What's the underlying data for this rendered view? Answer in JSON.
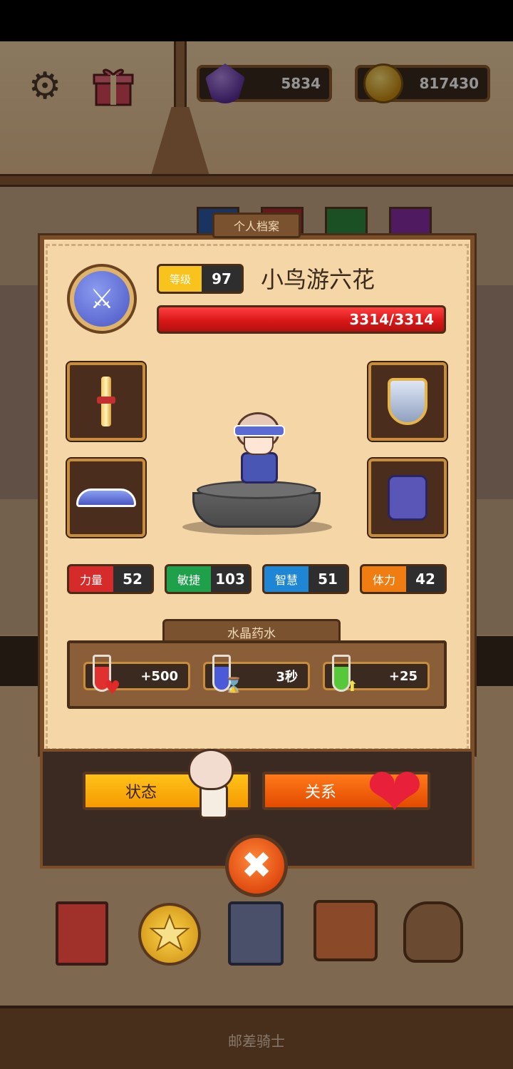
{
  "top_bar": {
    "gems": "5834",
    "coins": "817430"
  },
  "profile": {
    "tab_title": "个人档案",
    "level_label": "等级",
    "level": "97",
    "name": "小鸟游六花",
    "hp_text": "3314/3314",
    "hp_current": 3314,
    "hp_max": 3314
  },
  "equipment": {
    "weapon": "weapon-icon",
    "helmet": "helmet-icon",
    "shield": "shield-icon",
    "armor": "armor-icon"
  },
  "stats": [
    {
      "label": "力量",
      "value": "52",
      "color": "#d62b2b"
    },
    {
      "label": "敏捷",
      "value": "103",
      "color": "#1fa04a"
    },
    {
      "label": "智慧",
      "value": "51",
      "color": "#1f86d6"
    },
    {
      "label": "体力",
      "value": "42",
      "color": "#ef7d12"
    }
  ],
  "potions": {
    "header": "水晶药水",
    "items": [
      {
        "icon": "red-potion-heart-icon",
        "value": "+500"
      },
      {
        "icon": "blue-potion-hourglass-icon",
        "value": "3秒"
      },
      {
        "icon": "green-potion-arrow-icon",
        "value": "+25"
      }
    ]
  },
  "buttons": {
    "status": "状态",
    "relation": "关系",
    "close": "✖"
  },
  "bottom_nav": [
    "book-icon",
    "medal-icon",
    "cards-icon",
    "bag-icon",
    "shop-icon"
  ],
  "game_title": "邮差骑士",
  "colors": {
    "accent_orange": "#f59a00",
    "hp_red": "#d81818",
    "panel_bg": "#f5d6a6"
  }
}
